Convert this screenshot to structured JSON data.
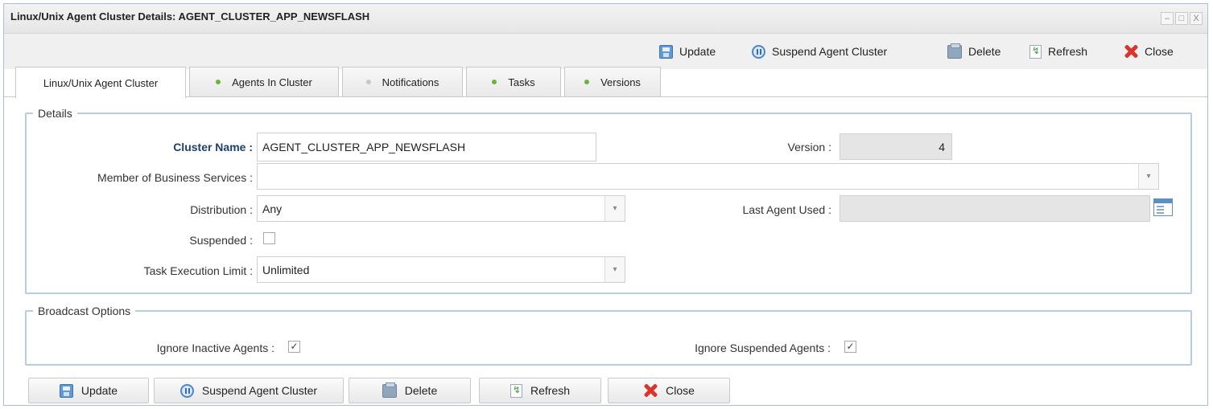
{
  "window": {
    "title": "Linux/Unix Agent Cluster Details: AGENT_CLUSTER_APP_NEWSFLASH",
    "controls": [
      "–",
      "□",
      "X"
    ]
  },
  "toolbar": {
    "update": "Update",
    "suspend": "Suspend Agent Cluster",
    "delete": "Delete",
    "refresh": "Refresh",
    "close": "Close"
  },
  "tabs": [
    {
      "label": "Linux/Unix Agent Cluster",
      "active": true
    },
    {
      "label": "Agents In Cluster",
      "dot_color": "#6cb33f"
    },
    {
      "label": "Notifications",
      "dot_color": "#c8c8c8"
    },
    {
      "label": "Tasks",
      "dot_color": "#6cb33f"
    },
    {
      "label": "Versions",
      "dot_color": "#6cb33f"
    }
  ],
  "details": {
    "legend": "Details",
    "cluster_name_label": "Cluster Name :",
    "cluster_name_value": "AGENT_CLUSTER_APP_NEWSFLASH",
    "version_label": "Version :",
    "version_value": "4",
    "member_label": "Member of Business Services :",
    "member_value": "",
    "distribution_label": "Distribution :",
    "distribution_value": "Any",
    "last_agent_label": "Last Agent Used :",
    "last_agent_value": "",
    "suspended_label": "Suspended :",
    "suspended_checked": false,
    "task_limit_label": "Task Execution Limit :",
    "task_limit_value": "Unlimited"
  },
  "broadcast": {
    "legend": "Broadcast Options",
    "ignore_inactive_label": "Ignore Inactive Agents :",
    "ignore_inactive_checked": true,
    "ignore_suspended_label": "Ignore Suspended Agents :",
    "ignore_suspended_checked": true
  },
  "bottom": {
    "update": "Update",
    "suspend": "Suspend Agent Cluster",
    "delete": "Delete",
    "refresh": "Refresh",
    "close": "Close"
  },
  "glyphs": {
    "check": "✓",
    "dropdown": "▾"
  }
}
